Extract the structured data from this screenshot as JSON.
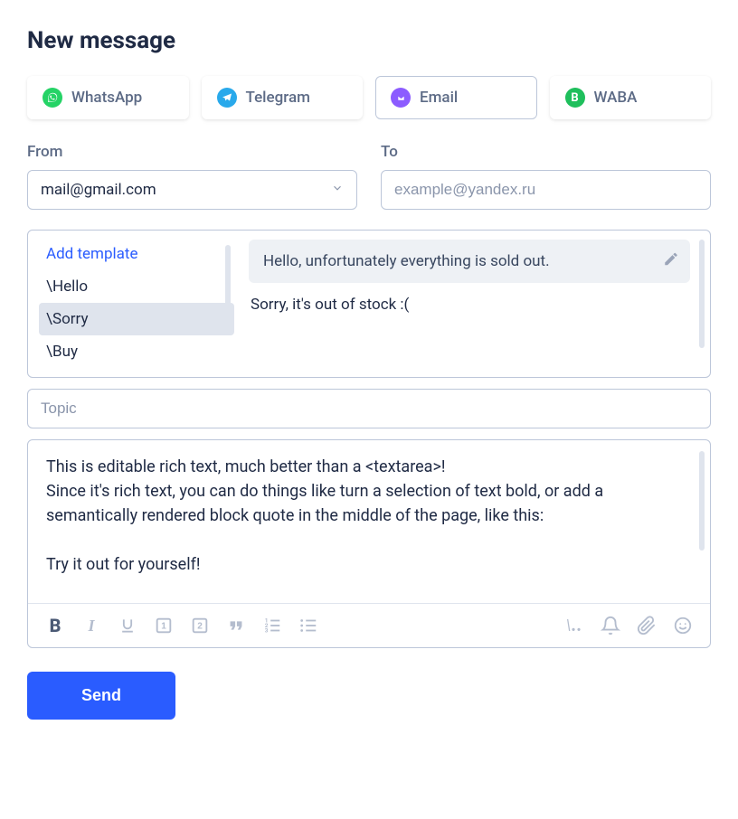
{
  "title": "New message",
  "channels": [
    {
      "id": "whatsapp",
      "label": "WhatsApp",
      "selected": false
    },
    {
      "id": "telegram",
      "label": "Telegram",
      "selected": false
    },
    {
      "id": "email",
      "label": "Email",
      "selected": true
    },
    {
      "id": "waba",
      "label": "WABA",
      "selected": false
    }
  ],
  "from": {
    "label": "From",
    "value": "mail@gmail.com"
  },
  "to": {
    "label": "To",
    "placeholder": "example@yandex.ru",
    "value": ""
  },
  "templates": {
    "add_label": "Add template",
    "items": [
      {
        "label": "\\Hello",
        "selected": false
      },
      {
        "label": "\\Sorry",
        "selected": true
      },
      {
        "label": "\\Buy",
        "selected": false
      }
    ],
    "preview_card": "Hello, unfortunately everything is sold out.",
    "preview_text": "Sorry, it's out of stock :("
  },
  "topic": {
    "placeholder": "Topic",
    "value": ""
  },
  "editor": {
    "content": "This is editable rich text, much better than a <textarea>!\nSince it's rich text, you can do things like turn a selection of text bold, or add a semantically rendered block quote in the middle of the page, like this:\n\nTry it out for yourself!"
  },
  "toolbar": {
    "slash_label": "\\.."
  },
  "send_label": "Send"
}
